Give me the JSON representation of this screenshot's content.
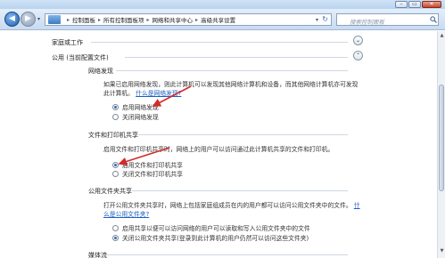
{
  "window": {
    "minimize_glyph": "–",
    "maximize_glyph": "▭",
    "close_glyph": "✕"
  },
  "nav": {
    "back_glyph": "◀",
    "forward_glyph": "▶",
    "dropdown_glyph": "▾",
    "breadcrumbs": [
      "控制面板",
      "所有控制面板项",
      "网络和共享中心",
      "高级共享设置"
    ],
    "separator": "▸",
    "address_dropdown_glyph": "▾",
    "refresh_glyph": "↻",
    "search_placeholder": "搜索控制面板"
  },
  "profiles": {
    "home": {
      "label": "家庭或工作",
      "toggle_glyph": "⌄"
    },
    "public": {
      "label": "公用 (当前配置文件)",
      "toggle_glyph": "⌃"
    }
  },
  "sections": {
    "network_discovery": {
      "heading": "网络发现",
      "description": "如果已启用网络发现，则此计算机可以发现其他网络计算机和设备，而其他网络计算机亦可发现此计算机。",
      "link": "什么是网络发现?",
      "options": [
        "启用网络发现",
        "关闭网络发现"
      ],
      "selected": 0
    },
    "file_printer_sharing": {
      "heading": "文件和打印机共享",
      "description": "启用文件和打印机共享时，网络上的用户可以访问通过此计算机共享的文件和打印机。",
      "options": [
        "启用文件和打印机共享",
        "关闭文件和打印机共享"
      ],
      "selected": 0
    },
    "public_folder_sharing": {
      "heading": "公用文件夹共享",
      "description": "打开公用文件夹共享时，网络上包括家庭组成员在内的用户都可以访问公用文件夹中的文件。",
      "link": "什么是公用文件夹?",
      "options": [
        "启用共享以便可以访问网络的用户可以读取和写入公用文件夹中的文件",
        "关闭公用文件夹共享(登录到此计算机的用户仍然可以访问这些文件夹)"
      ],
      "selected": 1
    },
    "media_streaming": {
      "heading": "媒体流"
    }
  },
  "annotations": {
    "arrow_color": "#d22b2b"
  }
}
